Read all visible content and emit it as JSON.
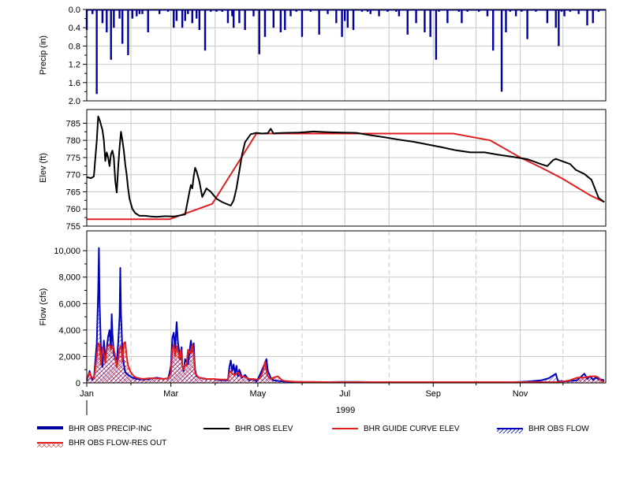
{
  "colors": {
    "precip": "#0000A0",
    "elev": "#000000",
    "guide": "#E02020",
    "flow": "#0000C0",
    "res_out": "#E02020",
    "grid": "#C8C8C8",
    "frame": "#000000"
  },
  "chart_data": [
    {
      "type": "bar",
      "name": "precip-panel",
      "ylabel": "Precip (in)",
      "y_inverted": true,
      "ylim": [
        0.0,
        2.0
      ],
      "yticks": [
        "0.0",
        "0.4",
        "0.8",
        "1.2",
        "1.6",
        "2.0"
      ],
      "grid": true,
      "series": [
        {
          "name": "BHR OBS PRECIP-INC",
          "x": [
            1,
            5,
            8,
            12,
            15,
            18,
            20,
            24,
            26,
            30,
            33,
            36,
            38,
            40,
            44,
            52,
            58,
            62,
            64,
            68,
            70,
            72,
            75,
            78,
            80,
            84,
            88,
            92,
            96,
            100,
            103,
            104,
            108,
            112,
            118,
            122,
            126,
            132,
            137,
            140,
            144,
            148,
            152,
            158,
            164,
            170,
            176,
            180,
            182,
            184,
            188,
            194,
            198,
            200,
            206,
            212,
            218,
            220,
            226,
            232,
            238,
            242,
            246,
            248,
            254,
            262,
            264,
            268,
            276,
            282,
            286,
            292,
            295,
            298,
            302,
            306,
            310,
            316,
            324,
            330,
            332,
            334,
            336,
            340,
            346,
            352,
            356,
            360
          ],
          "values": [
            0.45,
            0.1,
            1.85,
            0.3,
            0.5,
            1.1,
            0.4,
            0.2,
            0.75,
            1.0,
            0.2,
            0.15,
            0.1,
            0.1,
            0.5,
            0.1,
            0.05,
            0.4,
            0.25,
            0.4,
            0.25,
            0.1,
            0.3,
            0.2,
            0.45,
            0.9,
            0.05,
            0.05,
            0.05,
            0.3,
            0.15,
            0.4,
            0.3,
            0.45,
            0.15,
            0.98,
            0.6,
            0.4,
            0.5,
            0.45,
            0.15,
            0.05,
            0.6,
            0.05,
            0.55,
            0.1,
            0.3,
            0.6,
            0.25,
            0.4,
            0.45,
            0.05,
            0.05,
            0.1,
            0.15,
            0.05,
            0.05,
            0.15,
            0.55,
            0.3,
            0.5,
            0.6,
            1.1,
            0.05,
            0.3,
            0.05,
            0.3,
            0.05,
            0.05,
            0.15,
            0.9,
            1.8,
            0.5,
            0.05,
            0.15,
            0.05,
            0.65,
            0.05,
            0.3,
            0.4,
            0.8,
            0.05,
            0.15,
            0.05,
            0.1,
            0.35,
            0.3,
            0.05
          ]
        }
      ]
    },
    {
      "type": "line",
      "name": "elev-panel",
      "ylabel": "Elev (ft)",
      "ylim": [
        755,
        789
      ],
      "yticks": [
        "785",
        "780",
        "775",
        "770",
        "765",
        "760",
        "755"
      ],
      "grid": true,
      "series": [
        {
          "name": "BHR OBS ELEV",
          "x": [
            1,
            4,
            6,
            8,
            9,
            10,
            12,
            13,
            14,
            15,
            16,
            17,
            18,
            19,
            20,
            21,
            22,
            23,
            24,
            25,
            26,
            27,
            28,
            29,
            30,
            31,
            33,
            35,
            38,
            42,
            46,
            50,
            56,
            62,
            70,
            73,
            74,
            75,
            76,
            77,
            78,
            80,
            82,
            85,
            88,
            92,
            96,
            100,
            102,
            104,
            106,
            108,
            110,
            112,
            116,
            120,
            124,
            128,
            130,
            132,
            134,
            140,
            150,
            160,
            170,
            180,
            190,
            200,
            210,
            220,
            230,
            240,
            250,
            260,
            270,
            280,
            290,
            300,
            310,
            320,
            324,
            328,
            330,
            334,
            340,
            344,
            350,
            355,
            360,
            364
          ],
          "values": [
            769.3,
            769.0,
            769.5,
            780.0,
            787.0,
            786.0,
            783.0,
            780.0,
            774.0,
            776.5,
            775.0,
            772.5,
            776.0,
            777.0,
            775.0,
            768.0,
            764.8,
            772.0,
            778.0,
            782.5,
            780.0,
            777.0,
            773.0,
            770.0,
            766.0,
            763.0,
            760.0,
            758.8,
            758.0,
            758.0,
            757.8,
            757.7,
            757.9,
            757.8,
            758.4,
            765.0,
            767.0,
            766.0,
            769.5,
            772.0,
            771.0,
            768.0,
            763.5,
            766.0,
            765.0,
            763.0,
            762.0,
            761.3,
            761.0,
            762.5,
            766.0,
            771.0,
            776.0,
            779.5,
            781.8,
            782.2,
            782.0,
            782.1,
            783.4,
            782.0,
            782.1,
            782.2,
            782.3,
            782.6,
            782.4,
            782.3,
            782.2,
            781.5,
            780.9,
            780.2,
            779.6,
            778.8,
            778.0,
            777.1,
            776.5,
            776.5,
            775.8,
            775.2,
            774.5,
            773.0,
            772.5,
            774.2,
            774.6,
            774.0,
            773.1,
            771.4,
            770.2,
            768.5,
            763.2,
            762.0
          ]
        },
        {
          "name": "BHR GUIDE CURVE ELEV",
          "x": [
            1,
            59,
            89,
            120,
            258,
            284,
            305,
            320,
            334,
            354,
            364
          ],
          "values": [
            757.0,
            757.0,
            761.5,
            782.0,
            782.0,
            780.0,
            775.0,
            772.0,
            769.0,
            764.0,
            762.0
          ]
        }
      ]
    },
    {
      "type": "line",
      "name": "flow-panel",
      "ylabel": "Flow (cfs)",
      "ylim": [
        0,
        11500
      ],
      "yticks": [
        "10,000",
        "8,000",
        "6,000",
        "4,000",
        "2,000",
        "0"
      ],
      "xlabel": "1999",
      "xticks": [
        "Jan",
        "Mar",
        "May",
        "Jul",
        "Sep",
        "Nov"
      ],
      "xtick_days": [
        1,
        60,
        121,
        182,
        244,
        305
      ],
      "grid": true,
      "series": [
        {
          "name": "BHR OBS FLOW",
          "x": [
            1,
            3,
            4,
            5,
            6,
            7,
            8,
            9,
            9.5,
            10,
            11,
            12,
            13,
            14,
            15,
            16,
            17,
            18,
            18.5,
            19,
            20,
            21,
            22,
            23,
            24,
            24.5,
            25,
            26,
            27,
            28,
            30,
            33,
            36,
            40,
            45,
            50,
            55,
            58,
            59,
            60,
            61,
            62,
            63,
            64,
            65,
            66,
            67,
            67.5,
            68,
            69,
            70,
            72,
            74,
            75,
            76,
            76.5,
            77,
            78,
            80,
            85,
            90,
            95,
            100,
            101,
            102,
            103,
            104,
            105,
            106,
            107,
            108,
            110,
            112,
            115,
            118,
            120,
            122,
            126,
            127,
            128,
            130,
            132,
            135,
            140,
            145,
            150,
            160,
            170,
            180,
            190,
            200,
            210,
            220,
            230,
            240,
            250,
            260,
            270,
            280,
            290,
            300,
            305,
            310,
            315,
            320,
            325,
            330,
            331,
            332,
            334,
            336,
            340,
            345,
            350,
            352,
            354,
            356,
            358,
            360,
            364
          ],
          "values": [
            200,
            900,
            500,
            250,
            350,
            1600,
            3000,
            7000,
            10200,
            6000,
            2400,
            1200,
            3200,
            1800,
            2600,
            3500,
            4000,
            2600,
            5200,
            3800,
            2200,
            1800,
            1500,
            3000,
            5000,
            8700,
            5200,
            2400,
            1400,
            800,
            600,
            400,
            300,
            250,
            300,
            400,
            300,
            350,
            700,
            1300,
            3400,
            3800,
            2600,
            4600,
            3000,
            2300,
            1800,
            2700,
            1300,
            900,
            1800,
            1400,
            3200,
            2400,
            3000,
            1800,
            1000,
            500,
            400,
            300,
            300,
            200,
            200,
            1200,
            1700,
            900,
            1400,
            700,
            1300,
            500,
            1000,
            400,
            600,
            200,
            300,
            100,
            500,
            1500,
            1800,
            900,
            400,
            200,
            150,
            100,
            80,
            70,
            60,
            60,
            80,
            70,
            60,
            60,
            60,
            60,
            60,
            60,
            60,
            60,
            60,
            60,
            60,
            80,
            100,
            150,
            200,
            350,
            700,
            300,
            100,
            150,
            100,
            150,
            200,
            700,
            300,
            500,
            250,
            400,
            300,
            200
          ]
        },
        {
          "name": "BHR OBS FLOW-RES OUT",
          "x": [
            1,
            3,
            4,
            5,
            6,
            8,
            9,
            10,
            11,
            12,
            13,
            14,
            15,
            16,
            17,
            18,
            19,
            20,
            21,
            22,
            23,
            24,
            25,
            26,
            27,
            28,
            29,
            30,
            32,
            34,
            36,
            40,
            45,
            50,
            55,
            58,
            60,
            61,
            62,
            63,
            64,
            65,
            66,
            67,
            68,
            69,
            70,
            71,
            72,
            74,
            75,
            76,
            77,
            78,
            79,
            80,
            82,
            85,
            90,
            95,
            100,
            101,
            102,
            103,
            105,
            107,
            109,
            112,
            115,
            118,
            120,
            122,
            124,
            125,
            126,
            127,
            128,
            129,
            130,
            132,
            135,
            138,
            140,
            145,
            150,
            160,
            170,
            180,
            190,
            200,
            210,
            220,
            230,
            240,
            250,
            260,
            270,
            280,
            290,
            300,
            305,
            310,
            315,
            320,
            325,
            330,
            335,
            340,
            345,
            350,
            352,
            355,
            358,
            360,
            362,
            364
          ],
          "values": [
            300,
            800,
            500,
            400,
            300,
            2000,
            3000,
            2900,
            1400,
            2700,
            2200,
            1500,
            2600,
            2800,
            2900,
            2500,
            2800,
            2600,
            2000,
            1200,
            1800,
            2600,
            2800,
            1600,
            3000,
            3100,
            2000,
            1300,
            800,
            500,
            400,
            300,
            350,
            350,
            300,
            350,
            700,
            2500,
            2900,
            2000,
            2800,
            2400,
            1800,
            2500,
            1300,
            1000,
            1400,
            1300,
            2500,
            2200,
            2900,
            2100,
            800,
            600,
            450,
            400,
            350,
            300,
            300,
            250,
            250,
            800,
            900,
            700,
            600,
            800,
            500,
            450,
            300,
            300,
            250,
            300,
            700,
            1100,
            1600,
            900,
            500,
            350,
            300,
            400,
            500,
            200,
            150,
            100,
            80,
            70,
            60,
            60,
            60,
            60,
            60,
            60,
            60,
            60,
            60,
            60,
            60,
            60,
            60,
            60,
            60,
            60,
            60,
            60,
            60,
            60,
            100,
            200,
            400,
            400,
            450,
            500,
            500,
            400,
            150,
            100
          ]
        }
      ]
    }
  ],
  "legend": [
    {
      "key": "precip",
      "label": "BHR OBS PRECIP-INC",
      "style": "thick"
    },
    {
      "key": "elev",
      "label": "BHR OBS ELEV",
      "style": "line"
    },
    {
      "key": "guide",
      "label": "BHR GUIDE CURVE ELEV",
      "style": "line"
    },
    {
      "key": "flow",
      "label": "BHR OBS FLOW",
      "style": "hatch-blue"
    },
    {
      "key": "res_out",
      "label": "BHR OBS FLOW-RES OUT",
      "style": "hatch-red"
    }
  ]
}
